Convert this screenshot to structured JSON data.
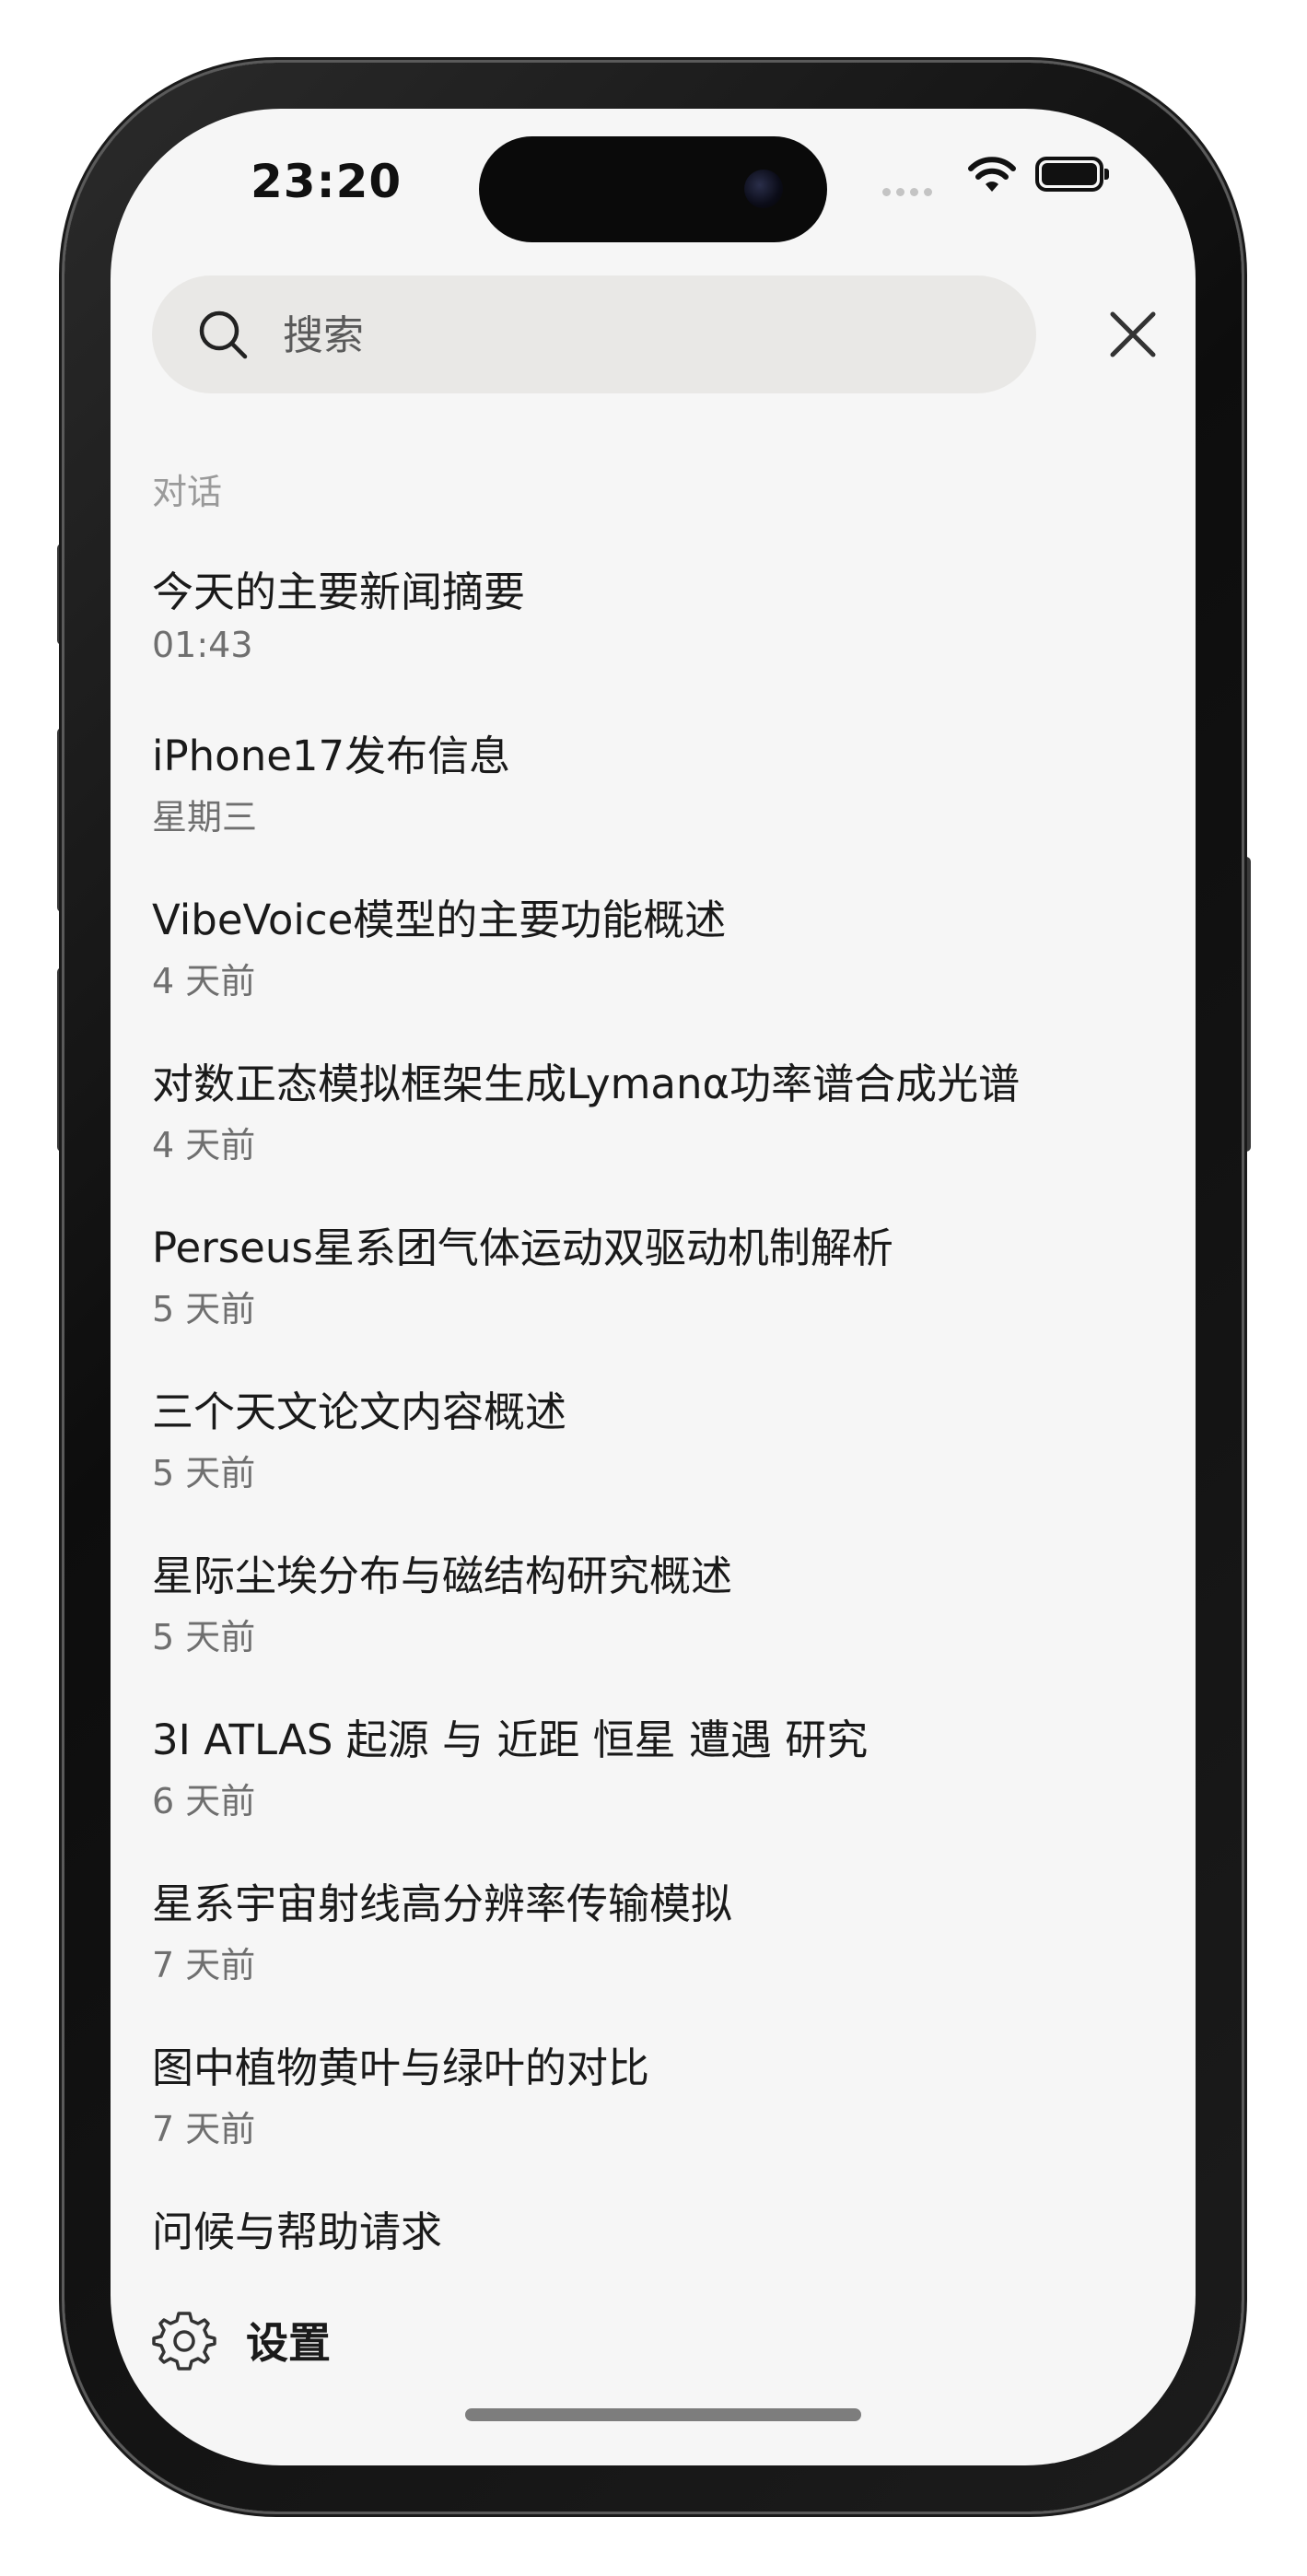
{
  "status_bar": {
    "time": "23:20"
  },
  "search": {
    "placeholder": "搜索",
    "value": ""
  },
  "section_label": "对话",
  "conversations": [
    {
      "title": "今天的主要新闻摘要",
      "time": "01:43"
    },
    {
      "title": "iPhone17发布信息",
      "time": "星期三"
    },
    {
      "title": "VibeVoice模型的主要功能概述",
      "time": "4 天前"
    },
    {
      "title": "对数正态模拟框架生成Lymanα功率谱合成光谱",
      "time": "4 天前"
    },
    {
      "title": "Perseus星系团气体运动双驱动机制解析",
      "time": "5 天前"
    },
    {
      "title": "三个天文论文内容概述",
      "time": "5 天前"
    },
    {
      "title": "星际尘埃分布与磁结构研究概述",
      "time": "5 天前"
    },
    {
      "title": "3I ATLAS 起源 与 近距 恒星 遭遇 研究",
      "time": "6 天前"
    },
    {
      "title": "星系宇宙射线高分辨率传输模拟",
      "time": "7 天前"
    },
    {
      "title": "图中植物黄叶与绿叶的对比",
      "time": "7 天前"
    },
    {
      "title": "问候与帮助请求",
      "time": ""
    }
  ],
  "settings": {
    "label": "设置"
  },
  "icons": {
    "search": "search-icon",
    "close": "close-icon",
    "settings": "gear-icon",
    "wifi": "wifi-icon",
    "battery": "battery-icon"
  }
}
